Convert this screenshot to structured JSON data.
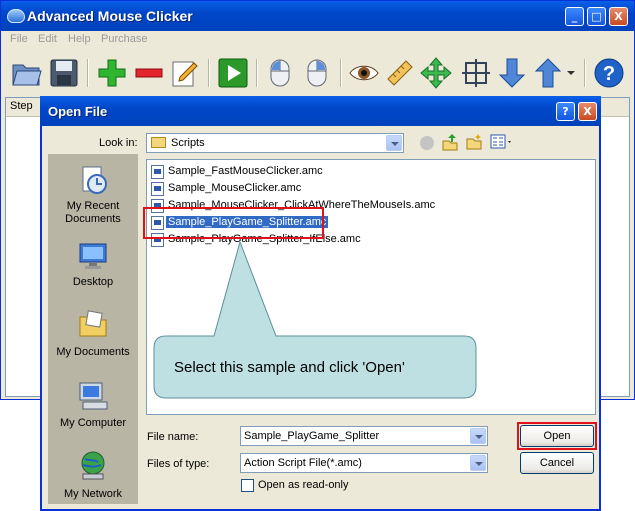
{
  "main_window": {
    "title": "Advanced Mouse Clicker",
    "menu": [
      "File",
      "Edit",
      "Help",
      "Purchase"
    ],
    "grid_header": "Step",
    "toolbar_icons": [
      "open-folder-icon",
      "save-icon",
      "add-icon",
      "remove-icon",
      "edit-icon",
      "play-icon",
      "left-click-icon",
      "right-click-icon",
      "watch-icon",
      "ruler-icon",
      "move-icon",
      "crosshair-icon",
      "move-down-icon",
      "move-up-icon",
      "help-icon"
    ]
  },
  "dialog": {
    "title": "Open File",
    "look_in_label": "Look in:",
    "look_in_value": "Scripts",
    "places": [
      {
        "label": "My Recent\nDocuments",
        "icon": "recent-documents-icon"
      },
      {
        "label": "Desktop",
        "icon": "desktop-icon"
      },
      {
        "label": "My Documents",
        "icon": "my-documents-icon"
      },
      {
        "label": "My Computer",
        "icon": "my-computer-icon"
      },
      {
        "label": "My Network",
        "icon": "my-network-icon"
      }
    ],
    "files": [
      "Sample_FastMouseClicker.amc",
      "Sample_MouseClicker.amc",
      "Sample_MouseClicker_ClickAtWhereTheMouseIs.amc",
      "Sample_PlayGame_Splitter.amc",
      "Sample_PlayGame_Splitter_IfElse.amc"
    ],
    "selected_file_index": 3,
    "file_name_label": "File name:",
    "file_name_value": "Sample_PlayGame_Splitter",
    "file_type_label": "Files of type:",
    "file_type_value": "Action Script File(*.amc)",
    "readonly_label": "Open as read-only",
    "open_button": "Open",
    "cancel_button": "Cancel",
    "help_button": "?",
    "close_button": "X"
  },
  "callout": {
    "text": "Select this sample and click 'Open'"
  },
  "colors": {
    "titlebar": "#0047c9",
    "selection": "#316ac5",
    "highlight": "#e0111a",
    "callout_fill": "#bfe0e3"
  }
}
